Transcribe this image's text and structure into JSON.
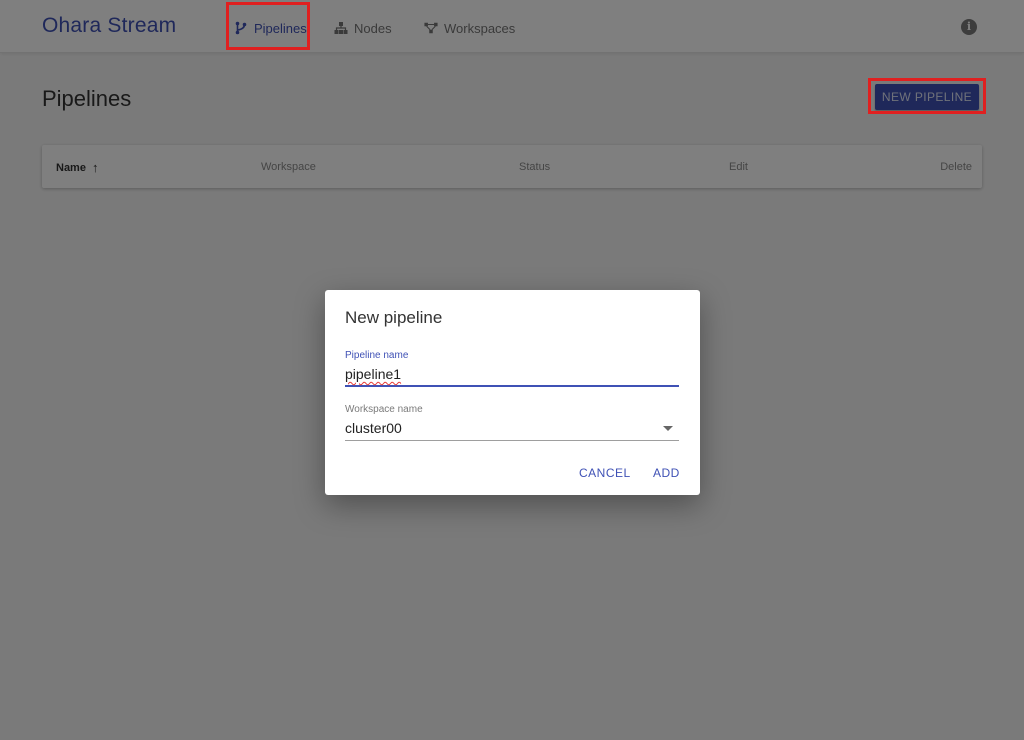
{
  "app": {
    "brand": "Ohara Stream"
  },
  "nav": {
    "items": [
      {
        "label": "Pipelines",
        "icon": "pipeline-branch-icon",
        "active": true
      },
      {
        "label": "Nodes",
        "icon": "nodes-hierarchy-icon",
        "active": false
      },
      {
        "label": "Workspaces",
        "icon": "workspaces-graph-icon",
        "active": false
      }
    ],
    "info_icon": "info-icon"
  },
  "page": {
    "title": "Pipelines",
    "new_button_label": "NEW PIPELINE"
  },
  "table": {
    "columns": [
      "Name",
      "Workspace",
      "Status",
      "Edit",
      "Delete"
    ],
    "sort_indicator": "↑"
  },
  "dialog": {
    "title": "New pipeline",
    "pipeline_field": {
      "label": "Pipeline name",
      "value": "pipeline1"
    },
    "workspace_field": {
      "label": "Workspace name",
      "value": "cluster00"
    },
    "cancel_label": "CANCEL",
    "add_label": "ADD"
  },
  "colors": {
    "accent": "#3f51b5",
    "highlight": "#e02020",
    "overlay": "rgba(0,0,0,0.5)"
  }
}
